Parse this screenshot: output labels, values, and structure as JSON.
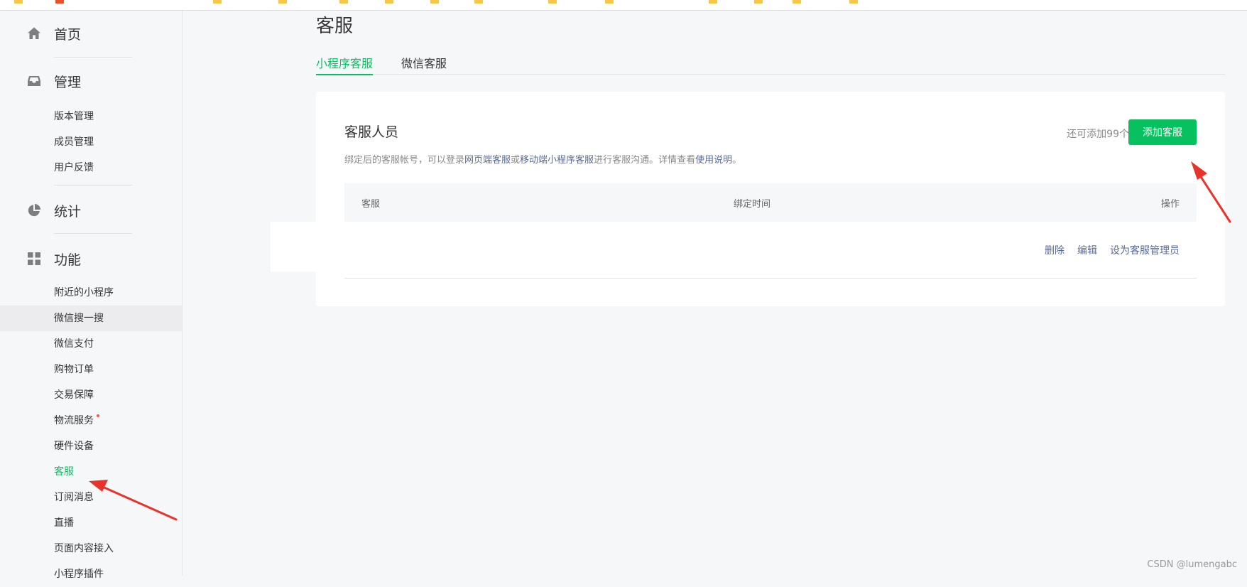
{
  "page_title": "客服",
  "sidebar": {
    "sections": [
      {
        "label": "首页",
        "icon": "home-icon"
      },
      {
        "label": "管理",
        "icon": "inbox-icon"
      },
      {
        "label": "统计",
        "icon": "pie-chart-icon"
      },
      {
        "label": "功能",
        "icon": "grid-icon"
      }
    ],
    "manage_items": [
      "版本管理",
      "成员管理",
      "用户反馈"
    ],
    "feature_items": [
      "附近的小程序",
      "微信搜一搜",
      "微信支付",
      "购物订单",
      "交易保障",
      "物流服务",
      "硬件设备",
      "客服",
      "订阅消息",
      "直播",
      "页面内容接入",
      "小程序插件"
    ],
    "hover_item": "微信搜一搜",
    "active_item": "客服",
    "badge_item": "物流服务"
  },
  "tabs": [
    {
      "label": "小程序客服",
      "active": true
    },
    {
      "label": "微信客服",
      "active": false
    }
  ],
  "card": {
    "title": "客服人员",
    "remaining": "还可添加99个",
    "add_button": "添加客服",
    "desc_1": "绑定后的客服帐号，可以登录",
    "desc_link_1": "网页端客服",
    "desc_2": "或",
    "desc_link_2": "移动端小程序客服",
    "desc_3": "进行客服沟通。详情查看",
    "desc_link_3": "使用说明",
    "desc_4": "。"
  },
  "table": {
    "headers": [
      "客服",
      "绑定时间",
      "操作"
    ],
    "rows": [
      {
        "actions": [
          "删除",
          "编辑",
          "设为客服管理员"
        ]
      }
    ]
  },
  "watermark": "CSDN @lumengabc",
  "colors": {
    "accent": "#07c160",
    "link": "#576b95",
    "annotation_arrow": "#e8332a"
  }
}
